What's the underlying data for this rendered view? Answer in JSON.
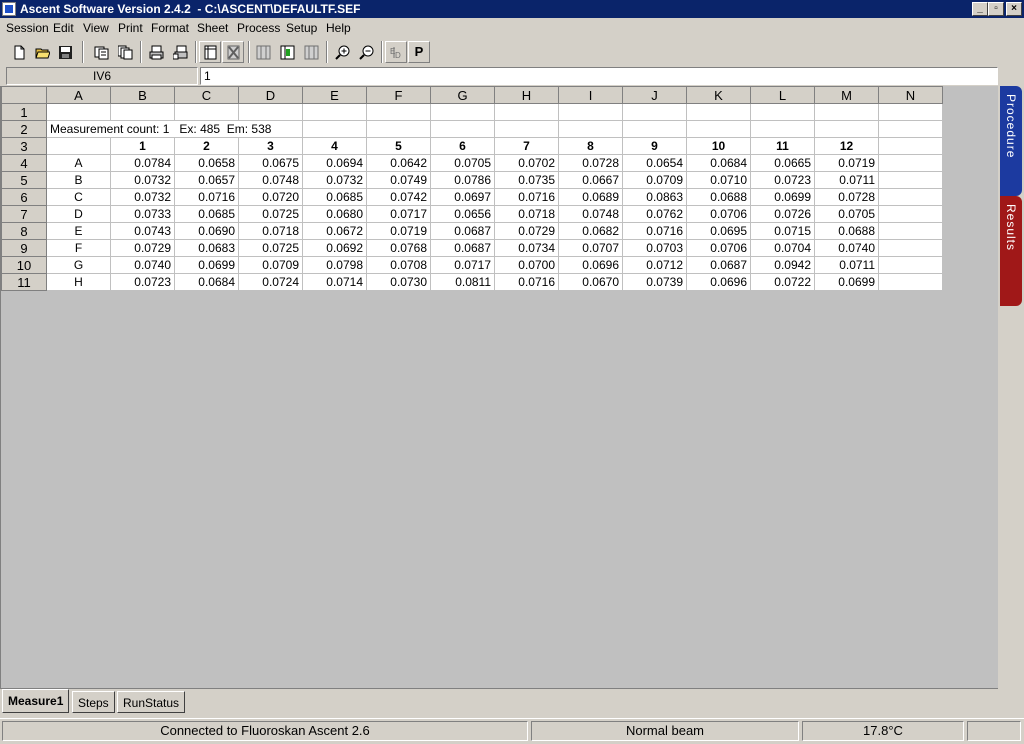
{
  "window": {
    "title": "Ascent Software Version 2.4.2  - C:\\ASCENT\\DEFAULTF.SEF",
    "minimize": "_",
    "maximize": "▫",
    "close": "×"
  },
  "menu": [
    "Session",
    "Edit",
    "View",
    "Print",
    "Format",
    "Sheet",
    "Process",
    "Setup",
    "Help"
  ],
  "toolbar": {
    "buttons": [
      "new-file-icon",
      "open-folder-icon",
      "save-icon",
      "copy-icon",
      "copy-multiple-icon",
      "print-icon",
      "print-preview-icon",
      "sheet-icon",
      "delete-sheet-icon",
      "columns-icon",
      "columns-insert-icon",
      "columns-delete-icon",
      "zoom-in-icon",
      "zoom-out-icon",
      "edit-formula-icon",
      "procedure-icon"
    ],
    "p_label": "P"
  },
  "formula_bar": {
    "cell_ref": "IV6",
    "value": "1"
  },
  "sheet": {
    "column_headers": [
      "A",
      "B",
      "C",
      "D",
      "E",
      "F",
      "G",
      "H",
      "I",
      "J",
      "K",
      "L",
      "M",
      "N"
    ],
    "row_headers": [
      "1",
      "2",
      "3",
      "4",
      "5",
      "6",
      "7",
      "8",
      "9",
      "10",
      "11"
    ],
    "info_text": "Measurement count: 1   Ex: 485  Em: 538",
    "plate_columns": [
      "1",
      "2",
      "3",
      "4",
      "5",
      "6",
      "7",
      "8",
      "9",
      "10",
      "11",
      "12"
    ],
    "plate_rows": [
      {
        "label": "A",
        "values": [
          "0.0784",
          "0.0658",
          "0.0675",
          "0.0694",
          "0.0642",
          "0.0705",
          "0.0702",
          "0.0728",
          "0.0654",
          "0.0684",
          "0.0665",
          "0.0719"
        ]
      },
      {
        "label": "B",
        "values": [
          "0.0732",
          "0.0657",
          "0.0748",
          "0.0732",
          "0.0749",
          "0.0786",
          "0.0735",
          "0.0667",
          "0.0709",
          "0.0710",
          "0.0723",
          "0.0711"
        ]
      },
      {
        "label": "C",
        "values": [
          "0.0732",
          "0.0716",
          "0.0720",
          "0.0685",
          "0.0742",
          "0.0697",
          "0.0716",
          "0.0689",
          "0.0863",
          "0.0688",
          "0.0699",
          "0.0728"
        ]
      },
      {
        "label": "D",
        "values": [
          "0.0733",
          "0.0685",
          "0.0725",
          "0.0680",
          "0.0717",
          "0.0656",
          "0.0718",
          "0.0748",
          "0.0762",
          "0.0706",
          "0.0726",
          "0.0705"
        ]
      },
      {
        "label": "E",
        "values": [
          "0.0743",
          "0.0690",
          "0.0718",
          "0.0672",
          "0.0719",
          "0.0687",
          "0.0729",
          "0.0682",
          "0.0716",
          "0.0695",
          "0.0715",
          "0.0688"
        ]
      },
      {
        "label": "F",
        "values": [
          "0.0729",
          "0.0683",
          "0.0725",
          "0.0692",
          "0.0768",
          "0.0687",
          "0.0734",
          "0.0707",
          "0.0703",
          "0.0706",
          "0.0704",
          "0.0740"
        ]
      },
      {
        "label": "G",
        "values": [
          "0.0740",
          "0.0699",
          "0.0709",
          "0.0798",
          "0.0708",
          "0.0717",
          "0.0700",
          "0.0696",
          "0.0712",
          "0.0687",
          "0.0942",
          "0.0711"
        ]
      },
      {
        "label": "H",
        "values": [
          "0.0723",
          "0.0684",
          "0.0724",
          "0.0714",
          "0.0730",
          "0.0811",
          "0.0716",
          "0.0670",
          "0.0739",
          "0.0696",
          "0.0722",
          "0.0699"
        ]
      }
    ]
  },
  "side_tabs": [
    "Procedure",
    "Results"
  ],
  "sheet_tabs": [
    "Measure1",
    "Steps",
    "RunStatus"
  ],
  "status": {
    "connection": "Connected to Fluoroskan Ascent 2.6",
    "beam": "Normal beam",
    "temperature": "17.8°C"
  },
  "colors": {
    "titlebar": "#0a246a",
    "procedure_tab": "#1c3aa0",
    "results_tab": "#a01818",
    "face": "#d4d0c8"
  }
}
